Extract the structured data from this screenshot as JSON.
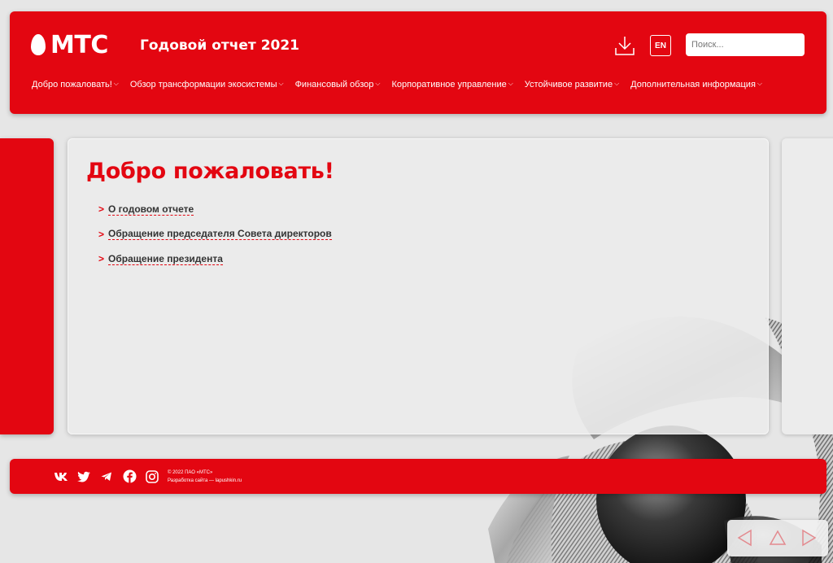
{
  "header": {
    "logo": "МТС",
    "report_title": "Годовой отчет 2021",
    "lang_label": "EN",
    "search_placeholder": "Поиск...",
    "nav": [
      {
        "label": "Добро пожаловать!"
      },
      {
        "label": "Обзор трансформации экосистемы"
      },
      {
        "label": "Финансовый обзор"
      },
      {
        "label": "Корпоративное управление"
      },
      {
        "label": "Устойчивое развитие"
      },
      {
        "label": "Дополнительная информация"
      }
    ]
  },
  "main": {
    "title": "Добро пожаловать!",
    "links": [
      {
        "label": "О годовом отчете"
      },
      {
        "label": "Обращение председателя Совета директоров"
      },
      {
        "label": "Обращение президента"
      }
    ]
  },
  "footer": {
    "copyright": "© 2022 ПАО «МТС»",
    "developer": "Разработка сайта — lapushkin.ru",
    "social_icons": [
      "vk-icon",
      "twitter-icon",
      "telegram-icon",
      "facebook-icon",
      "instagram-icon"
    ]
  },
  "colors": {
    "brand_red": "#e30611",
    "background": "#e6e6e6"
  }
}
